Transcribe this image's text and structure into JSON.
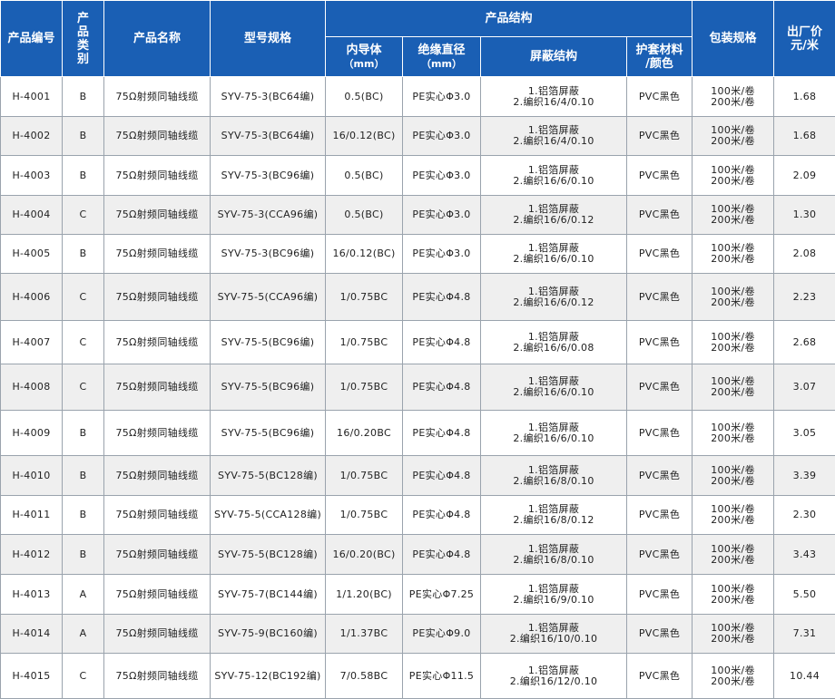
{
  "headers": {
    "code": "产品编号",
    "category_lines": [
      "产",
      "品",
      "类",
      "别"
    ],
    "name": "产品名称",
    "model": "型号规格",
    "structure": "产品结构",
    "conductor_lines": [
      "内导体",
      "（mm）"
    ],
    "diameter_lines": [
      "绝缘直径",
      "（mm）"
    ],
    "shield": "屏蔽结构",
    "jacket_lines": [
      "护套材料",
      "/颜色"
    ],
    "packing": "包装规格",
    "price_lines": [
      "出厂价",
      "元/米"
    ]
  },
  "rows": [
    {
      "code": "H-4001",
      "cat": "B",
      "name": "75Ω射频同轴线缆",
      "model": "SYV-75-3(BC64编)",
      "conductor": "0.5(BC)",
      "diameter": "PE实心Φ3.0",
      "shield1": "1.铝箔屏蔽",
      "shield2": "2.编织16/4/0.10",
      "jacket": "PVC黑色",
      "pack1": "100米/卷",
      "pack2": "200米/卷",
      "price": "1.68"
    },
    {
      "code": "H-4002",
      "cat": "B",
      "name": "75Ω射频同轴线缆",
      "model": "SYV-75-3(BC64编)",
      "conductor": "16/0.12(BC)",
      "diameter": "PE实心Φ3.0",
      "shield1": "1.铝箔屏蔽",
      "shield2": "2.编织16/4/0.10",
      "jacket": "PVC黑色",
      "pack1": "100米/卷",
      "pack2": "200米/卷",
      "price": "1.68"
    },
    {
      "code": "H-4003",
      "cat": "B",
      "name": "75Ω射频同轴线缆",
      "model": "SYV-75-3(BC96编)",
      "conductor": "0.5(BC)",
      "diameter": "PE实心Φ3.0",
      "shield1": "1.铝箔屏蔽",
      "shield2": "2.编织16/6/0.10",
      "jacket": "PVC黑色",
      "pack1": "100米/卷",
      "pack2": "200米/卷",
      "price": "2.09"
    },
    {
      "code": "H-4004",
      "cat": "C",
      "name": "75Ω射频同轴线缆",
      "model": "SYV-75-3(CCA96编)",
      "conductor": "0.5(BC)",
      "diameter": "PE实心Φ3.0",
      "shield1": "1.铝箔屏蔽",
      "shield2": "2.编织16/6/0.12",
      "jacket": "PVC黑色",
      "pack1": "100米/卷",
      "pack2": "200米/卷",
      "price": "1.30"
    },
    {
      "code": "H-4005",
      "cat": "B",
      "name": "75Ω射频同轴线缆",
      "model": "SYV-75-3(BC96编)",
      "conductor": "16/0.12(BC)",
      "diameter": "PE实心Φ3.0",
      "shield1": "1.铝箔屏蔽",
      "shield2": "2.编织16/6/0.10",
      "jacket": "PVC黑色",
      "pack1": "100米/卷",
      "pack2": "200米/卷",
      "price": "2.08"
    },
    {
      "code": "H-4006",
      "cat": "C",
      "name": "75Ω射频同轴线缆",
      "model": "SYV-75-5(CCA96编)",
      "conductor": "1/0.75BC",
      "diameter": "PE实心Φ4.8",
      "shield1": "1.铝箔屏蔽",
      "shield2": "2.编织16/6/0.12",
      "jacket": "PVC黑色",
      "pack1": "100米/卷",
      "pack2": "200米/卷",
      "price": "2.23"
    },
    {
      "code": "H-4007",
      "cat": "C",
      "name": "75Ω射频同轴线缆",
      "model": "SYV-75-5(BC96编)",
      "conductor": "1/0.75BC",
      "diameter": "PE实心Φ4.8",
      "shield1": "1.铝箔屏蔽",
      "shield2": "2.编织16/6/0.08",
      "jacket": "PVC黑色",
      "pack1": "100米/卷",
      "pack2": "200米/卷",
      "price": "2.68"
    },
    {
      "code": "H-4008",
      "cat": "C",
      "name": "75Ω射频同轴线缆",
      "model": "SYV-75-5(BC96编)",
      "conductor": "1/0.75BC",
      "diameter": "PE实心Φ4.8",
      "shield1": "1.铝箔屏蔽",
      "shield2": "2.编织16/6/0.10",
      "jacket": "PVC黑色",
      "pack1": "100米/卷",
      "pack2": "200米/卷",
      "price": "3.07"
    },
    {
      "code": "H-4009",
      "cat": "B",
      "name": "75Ω射频同轴线缆",
      "model": "SYV-75-5(BC96编)",
      "conductor": "16/0.20BC",
      "diameter": "PE实心Φ4.8",
      "shield1": "1.铝箔屏蔽",
      "shield2": "2.编织16/6/0.10",
      "jacket": "PVC黑色",
      "pack1": "100米/卷",
      "pack2": "200米/卷",
      "price": "3.05"
    },
    {
      "code": "H-4010",
      "cat": "B",
      "name": "75Ω射频同轴线缆",
      "model": "SYV-75-5(BC128编)",
      "conductor": "1/0.75BC",
      "diameter": "PE实心Φ4.8",
      "shield1": "1.铝箔屏蔽",
      "shield2": "2.编织16/8/0.10",
      "jacket": "PVC黑色",
      "pack1": "100米/卷",
      "pack2": "200米/卷",
      "price": "3.39"
    },
    {
      "code": "H-4011",
      "cat": "B",
      "name": "75Ω射频同轴线缆",
      "model": "SYV-75-5(CCA128编)",
      "conductor": "1/0.75BC",
      "diameter": "PE实心Φ4.8",
      "shield1": "1.铝箔屏蔽",
      "shield2": "2.编织16/8/0.12",
      "jacket": "PVC黑色",
      "pack1": "100米/卷",
      "pack2": "200米/卷",
      "price": "2.30"
    },
    {
      "code": "H-4012",
      "cat": "B",
      "name": "75Ω射频同轴线缆",
      "model": "SYV-75-5(BC128编)",
      "conductor": "16/0.20(BC)",
      "diameter": "PE实心Φ4.8",
      "shield1": "1.铝箔屏蔽",
      "shield2": "2.编织16/8/0.10",
      "jacket": "PVC黑色",
      "pack1": "100米/卷",
      "pack2": "200米/卷",
      "price": "3.43"
    },
    {
      "code": "H-4013",
      "cat": "A",
      "name": "75Ω射频同轴线缆",
      "model": "SYV-75-7(BC144编)",
      "conductor": "1/1.20(BC)",
      "diameter": "PE实心Φ7.25",
      "shield1": "1.铝箔屏蔽",
      "shield2": "2.编织16/9/0.10",
      "jacket": "PVC黑色",
      "pack1": "100米/卷",
      "pack2": "200米/卷",
      "price": "5.50"
    },
    {
      "code": "H-4014",
      "cat": "A",
      "name": "75Ω射频同轴线缆",
      "model": "SYV-75-9(BC160编)",
      "conductor": "1/1.37BC",
      "diameter": "PE实心Φ9.0",
      "shield1": "1.铝箔屏蔽",
      "shield2": "2.编织16/10/0.10",
      "jacket": "PVC黑色",
      "pack1": "100米/卷",
      "pack2": "200米/卷",
      "price": "7.31"
    },
    {
      "code": "H-4015",
      "cat": "C",
      "name": "75Ω射频同轴线缆",
      "model": "SYV-75-12(BC192编)",
      "conductor": "7/0.58BC",
      "diameter": "PE实心Φ11.5",
      "shield1": "1.铝箔屏蔽",
      "shield2": "2.编织16/12/0.10",
      "jacket": "PVC黑色",
      "pack1": "100米/卷",
      "pack2": "200米/卷",
      "price": "10.44"
    }
  ]
}
